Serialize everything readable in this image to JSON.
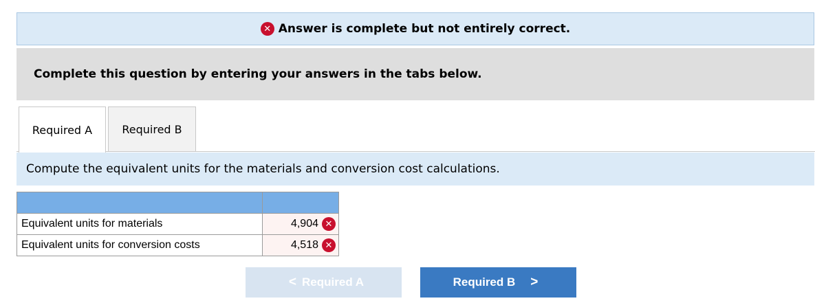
{
  "banner": {
    "message": "Answer is complete but not entirely correct.",
    "icon": "x-circle-icon",
    "icon_color": "#c8102e"
  },
  "instructions": {
    "text": "Complete this question by entering your answers in the tabs below."
  },
  "tabs": [
    {
      "label": "Required A",
      "active": true
    },
    {
      "label": "Required B",
      "active": false
    }
  ],
  "question": {
    "text": "Compute the equivalent units for the materials and conversion cost calculations."
  },
  "table": {
    "header": [
      "",
      ""
    ],
    "rows": [
      {
        "label": "Equivalent units for materials",
        "value": "4,904",
        "status": "incorrect"
      },
      {
        "label": "Equivalent units for conversion costs",
        "value": "4,518",
        "status": "incorrect"
      }
    ]
  },
  "nav": {
    "prev_label": "Required A",
    "prev_chevron": "<",
    "next_label": "Required B",
    "next_chevron": ">"
  },
  "colors": {
    "accent": "#3a7ac2",
    "header_blue": "#77aee6",
    "banner_bg": "#dbeaf7",
    "error": "#c8102e"
  }
}
